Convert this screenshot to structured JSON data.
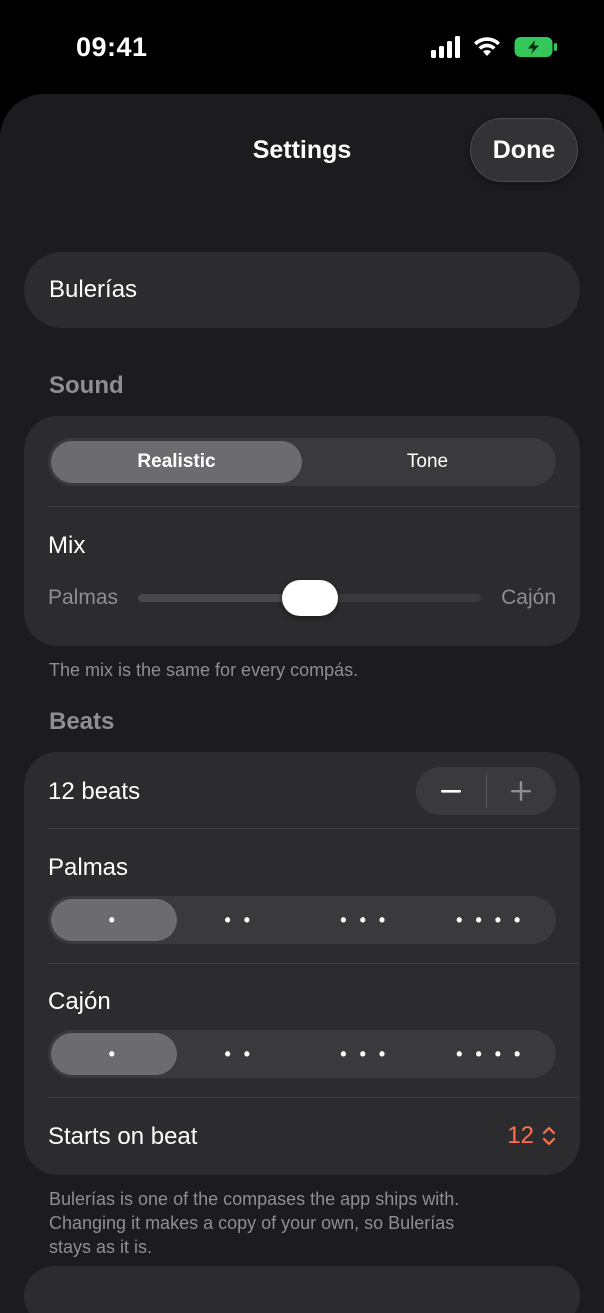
{
  "status_bar": {
    "time": "09:41",
    "icons": [
      "cellular-signal-icon",
      "wifi-icon",
      "battery-charging-icon"
    ],
    "battery_color": "#34c759"
  },
  "header": {
    "title": "Settings",
    "done_label": "Done"
  },
  "name_field": {
    "value": "Bulerías"
  },
  "sound": {
    "header": "Sound",
    "segments": [
      {
        "label": "Realistic",
        "selected": true
      },
      {
        "label": "Tone",
        "selected": false
      }
    ],
    "mix_label": "Mix",
    "slider_min_label": "Palmas",
    "slider_max_label": "Cajón",
    "slider_value": 0.5,
    "footnote": "The mix is the same for every compás."
  },
  "beats": {
    "header": "Beats",
    "count_label": "12 beats",
    "palmas": {
      "label": "Palmas",
      "options": [
        "•",
        "• •",
        "• • •",
        "• • • •"
      ],
      "selected_index": 0
    },
    "cajon": {
      "label": "Cajón",
      "options": [
        "•",
        "• •",
        "• • •",
        "• • • •"
      ],
      "selected_index": 0
    },
    "starts_on_label": "Starts on beat",
    "starts_on_value": "12",
    "footnote_line1": "Bulerías is one of the compases the app ships with.",
    "footnote_line2": "Changing it makes a copy of your own, so Bulerías",
    "footnote_line3": "stays as it is."
  },
  "colors": {
    "accent": "#ff6f4e",
    "sheet_bg": "#1c1c1e",
    "card_bg": "#2c2c2e"
  }
}
